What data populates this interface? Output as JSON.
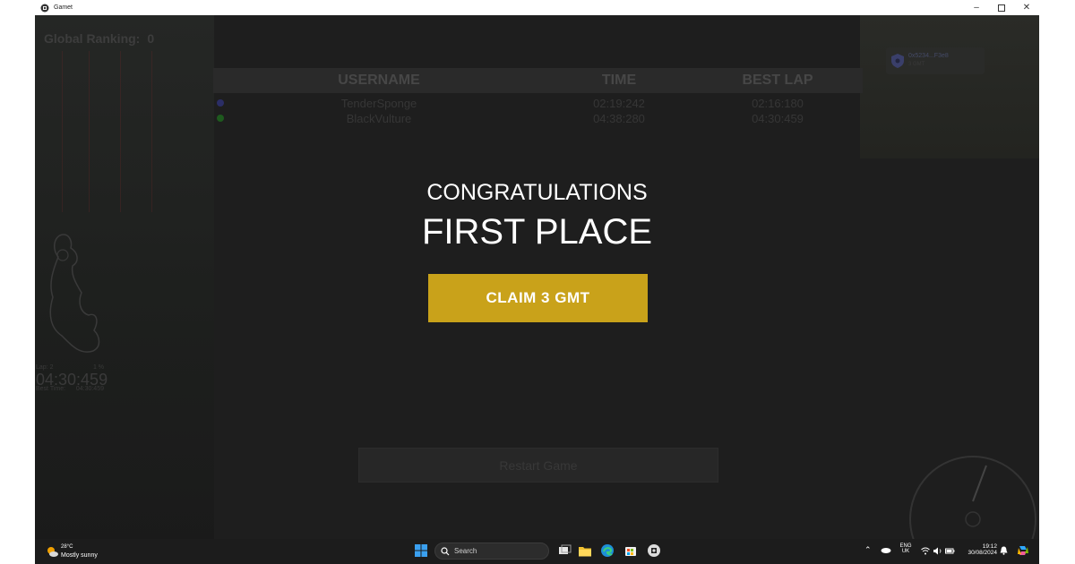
{
  "window": {
    "title": "Gamet"
  },
  "hud": {
    "global_ranking_label": "Global Ranking:",
    "global_ranking_value": "0",
    "player": {
      "address": "0x5234...F3e8",
      "subtitle": "3 GMT"
    }
  },
  "leaderboard": {
    "headers": {
      "username": "USERNAME",
      "time": "TIME",
      "best_lap": "BEST LAP"
    },
    "rows": [
      {
        "color": "#2b2e66",
        "username": "TenderSponge",
        "time": "02:19:242",
        "best_lap": "02:16:180"
      },
      {
        "color": "#1e5a1e",
        "username": "BlackVulture",
        "time": "04:38:280",
        "best_lap": "04:30:459"
      }
    ]
  },
  "result": {
    "congrats": "CONGRATULATIONS",
    "place": "FIRST PLACE",
    "claim_label": "CLAIM 3 GMT",
    "claim_color": "#c9a21a"
  },
  "lap": {
    "lap_label": "Lap: 2",
    "percent": "1 %",
    "current_time": "04:30:459",
    "best_label": "Best Time:",
    "best_value": "04:30:459"
  },
  "restart_label": "Restart Game",
  "taskbar": {
    "weather_temp": "28°C",
    "weather_desc": "Mostly sunny",
    "search_placeholder": "Search",
    "lang_line1": "ENG",
    "lang_line2": "UK",
    "time": "19:12",
    "date": "30/08/2024",
    "icons": [
      "start-icon",
      "search-icon",
      "task-view-icon",
      "file-explorer-icon",
      "edge-icon",
      "store-icon",
      "gamet-icon"
    ]
  }
}
